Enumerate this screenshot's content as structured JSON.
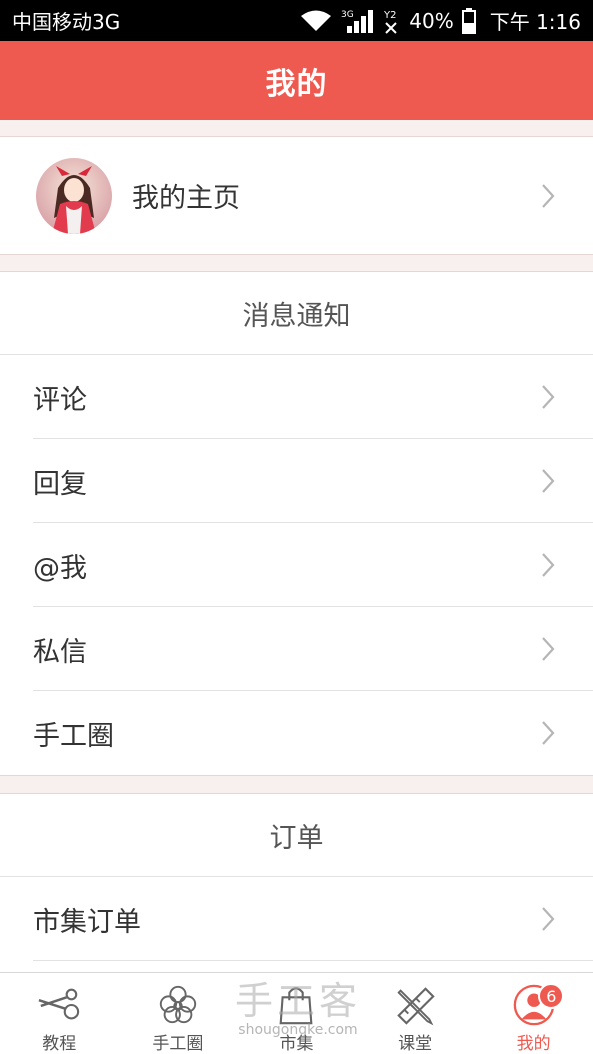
{
  "status_bar": {
    "carrier": "中国移动3G",
    "network_type": "3G",
    "sim2": "Y2",
    "battery": "40%",
    "time": "下午 1:16"
  },
  "header": {
    "title": "我的"
  },
  "profile": {
    "label": "我的主页"
  },
  "messages": {
    "title": "消息通知",
    "items": [
      {
        "label": "评论"
      },
      {
        "label": "回复"
      },
      {
        "label": "@我"
      },
      {
        "label": "私信"
      },
      {
        "label": "手工圈"
      }
    ]
  },
  "orders": {
    "title": "订单",
    "items": [
      {
        "label": "市集订单"
      }
    ]
  },
  "tabbar": {
    "tabs": [
      {
        "label": "教程",
        "icon": "scissors-icon"
      },
      {
        "label": "手工圈",
        "icon": "flower-icon"
      },
      {
        "label": "市集",
        "icon": "shopping-bag-icon"
      },
      {
        "label": "课堂",
        "icon": "ruler-pencil-icon"
      },
      {
        "label": "我的",
        "icon": "user-circle-icon",
        "badge": "6",
        "active": true
      }
    ]
  },
  "watermark": {
    "text": "手工客",
    "url": "shougongke.com"
  },
  "colors": {
    "accent": "#ef5a50",
    "background": "#f8efef"
  }
}
